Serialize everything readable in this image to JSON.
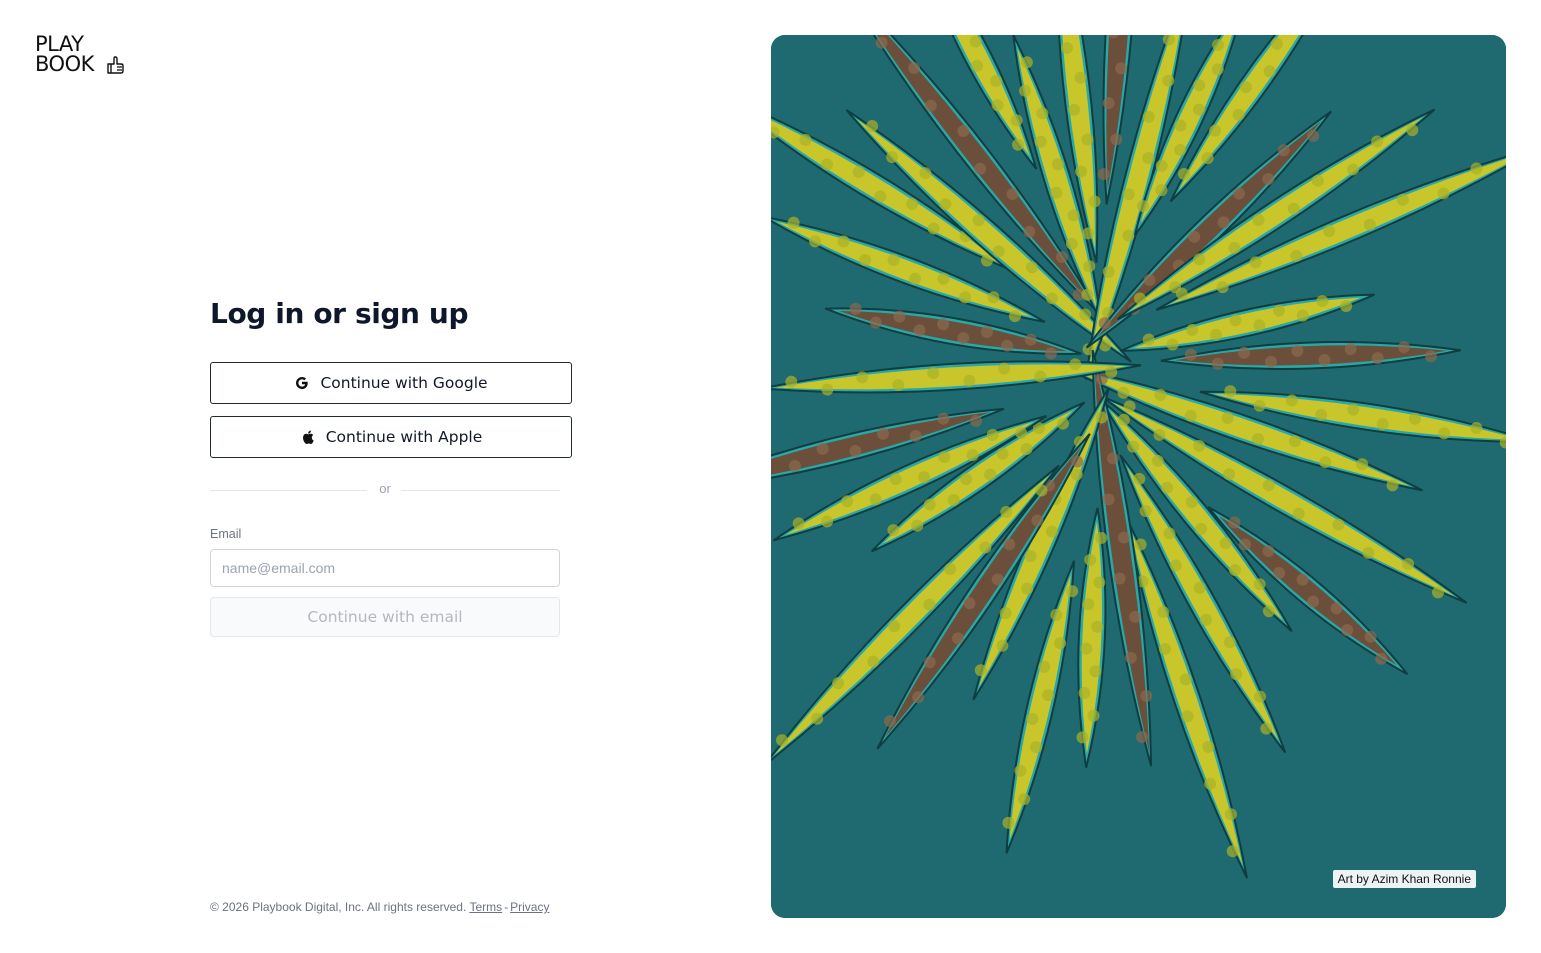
{
  "brand": {
    "logo_line1": "PLAY",
    "logo_line2": "BOOK",
    "logo_icon": "thumbs-up-hand-icon"
  },
  "auth": {
    "title": "Log in or sign up",
    "google_label": "Continue with Google",
    "google_icon": "google-g-icon",
    "apple_label": "Continue with Apple",
    "apple_icon": "apple-logo-icon",
    "divider_text": "or",
    "email_label": "Email",
    "email_placeholder": "name@email.com",
    "email_value": "",
    "email_submit_label": "Continue with email"
  },
  "footer": {
    "copyright": "© 2026 Playbook Digital, Inc. All rights reserved.",
    "terms_label": "Terms",
    "separator": "-",
    "privacy_label": "Privacy"
  },
  "artwork": {
    "credit": "Art by Azim Khan Ronnie",
    "colors": {
      "water": "#1f6a70",
      "boat": "#2aa7a7",
      "fruit": "#c8c62a",
      "deck": "#6b4f3a"
    }
  }
}
